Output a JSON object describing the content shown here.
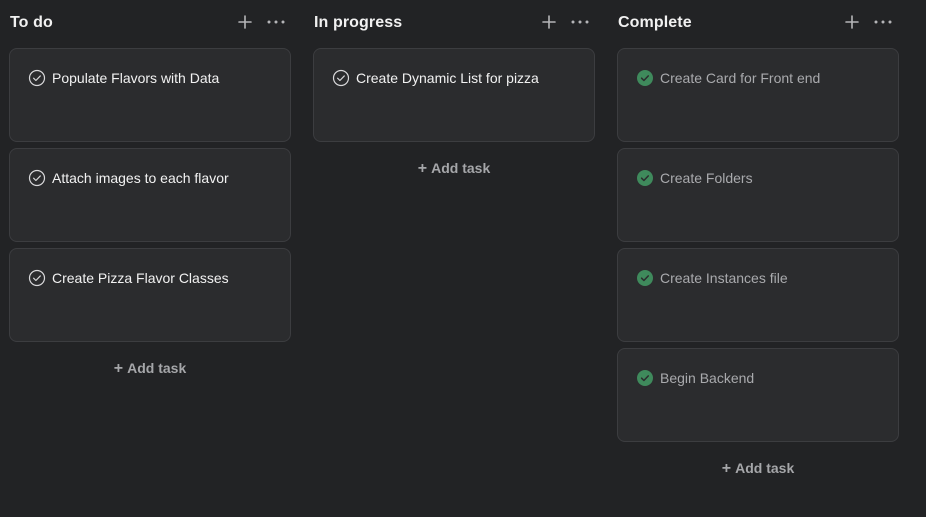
{
  "columns": [
    {
      "title": "To do",
      "add_icon": "plus-icon",
      "more_icon": "more-horizontal-icon",
      "add_task_label": "Add task",
      "tasks": [
        {
          "title": "Populate Flavors with Data",
          "completed": false
        },
        {
          "title": "Attach images to each flavor",
          "completed": false
        },
        {
          "title": "Create Pizza Flavor Classes",
          "completed": false
        }
      ]
    },
    {
      "title": "In progress",
      "add_icon": "plus-icon",
      "more_icon": "more-horizontal-icon",
      "add_task_label": "Add task",
      "tasks": [
        {
          "title": "Create Dynamic List for pizza",
          "completed": false
        }
      ]
    },
    {
      "title": "Complete",
      "add_icon": "plus-icon",
      "more_icon": "more-horizontal-icon",
      "add_task_label": "Add task",
      "tasks": [
        {
          "title": "Create Card for Front end",
          "completed": true
        },
        {
          "title": "Create Folders",
          "completed": true
        },
        {
          "title": "Create Instances file",
          "completed": true
        },
        {
          "title": "Begin Backend",
          "completed": true
        }
      ]
    }
  ],
  "colors": {
    "background": "#222325",
    "card": "#2b2c2e",
    "card_border": "#3c3d40",
    "completed_check": "#3f8a5c"
  }
}
